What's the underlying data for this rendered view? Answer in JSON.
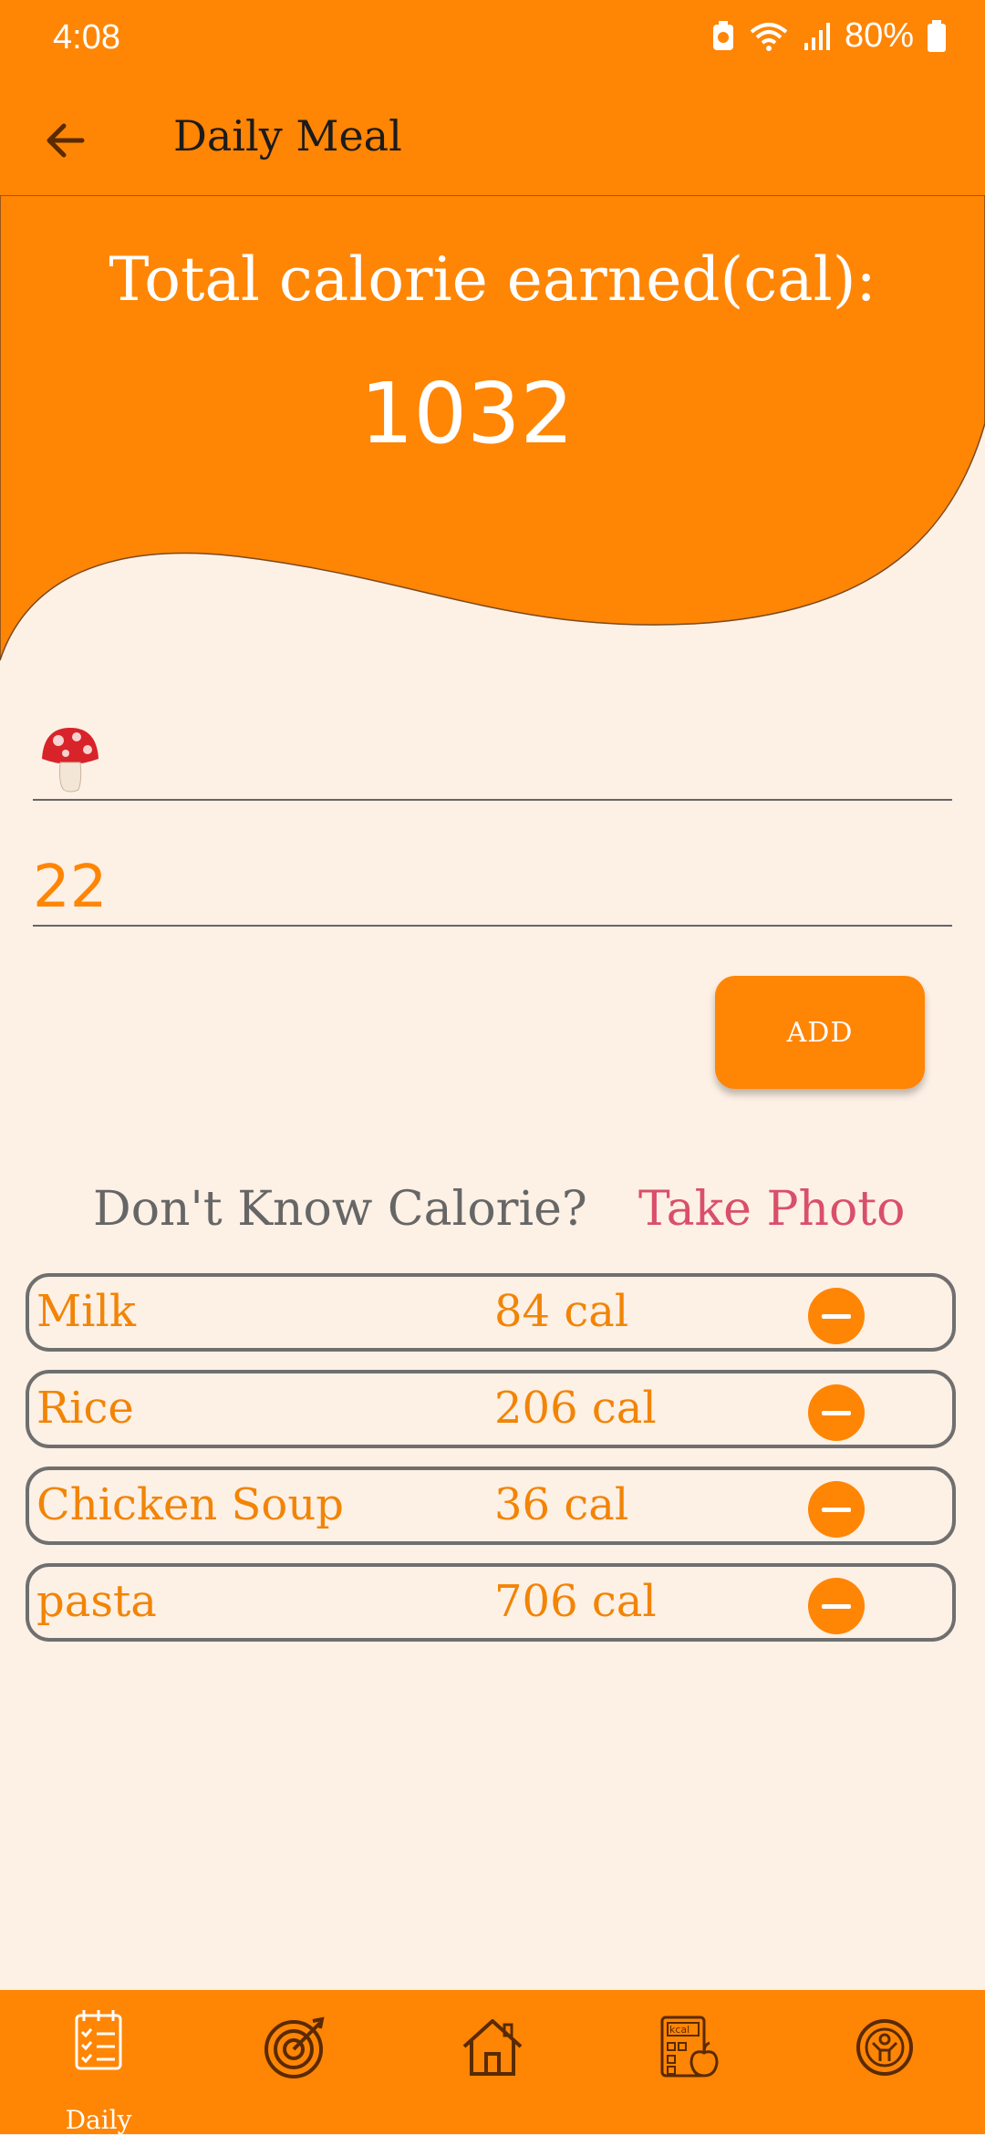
{
  "status_bar": {
    "time": "4:08",
    "battery": "80%"
  },
  "app_bar": {
    "title": "Daily Meal",
    "back_icon": "arrow-left-icon"
  },
  "summary": {
    "label": "Total calorie earned(cal):",
    "value": "1032"
  },
  "form": {
    "food_emoji": "🍄",
    "calorie_value": "22",
    "add_label": "ADD"
  },
  "prompt": {
    "unknown_label": "Don't Know Calorie?",
    "take_photo_label": "Take Photo"
  },
  "meals": [
    {
      "name": "Milk",
      "calories": "84 cal"
    },
    {
      "name": "Rice",
      "calories": "206 cal"
    },
    {
      "name": "Chicken Soup",
      "calories": "36 cal"
    },
    {
      "name": "pasta",
      "calories": "706 cal"
    }
  ],
  "bottom_nav": {
    "items": [
      {
        "label": "Daily",
        "icon": "checklist-icon"
      },
      {
        "label": "",
        "icon": "target-icon"
      },
      {
        "label": "",
        "icon": "home-icon"
      },
      {
        "label": "",
        "icon": "kcal-calculator-icon"
      },
      {
        "label": "",
        "icon": "fitness-person-icon"
      }
    ]
  },
  "colors": {
    "primary": "#FF8505",
    "background": "#FDF0E5",
    "accent_pink": "#D94F6A",
    "text_orange": "#F28406"
  }
}
